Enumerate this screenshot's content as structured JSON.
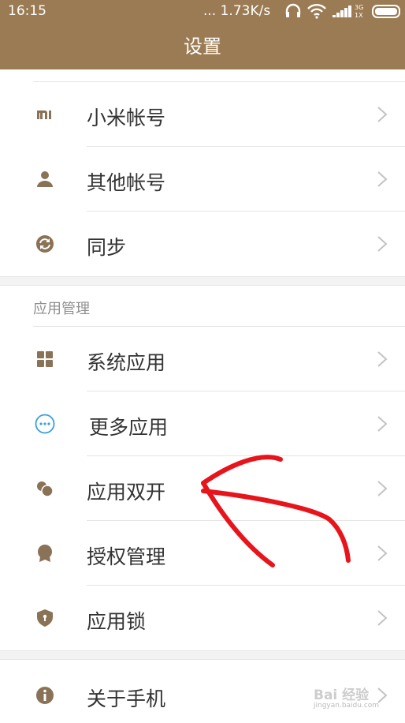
{
  "status_bar": {
    "time": "16:15",
    "network_speed": "... 1.73K/s",
    "signal_label": "3G",
    "signal_sublabel": "1X",
    "icons": [
      "headphone-icon",
      "wifi-icon",
      "signal-icon",
      "battery-icon"
    ]
  },
  "header": {
    "title": "设置"
  },
  "accounts": {
    "items": [
      {
        "label": "小米帐号",
        "icon": "mi-logo-icon"
      },
      {
        "label": "其他帐号",
        "icon": "person-icon"
      },
      {
        "label": "同步",
        "icon": "sync-icon"
      }
    ]
  },
  "app_management": {
    "header": "应用管理",
    "items": [
      {
        "label": "系统应用",
        "icon": "grid-icon"
      },
      {
        "label": "更多应用",
        "icon": "more-dots-icon"
      },
      {
        "label": "应用双开",
        "icon": "dual-app-icon"
      },
      {
        "label": "授权管理",
        "icon": "badge-icon"
      },
      {
        "label": "应用锁",
        "icon": "shield-lock-icon"
      }
    ]
  },
  "about": {
    "items": [
      {
        "label": "关于手机",
        "icon": "info-icon"
      }
    ]
  },
  "watermark": {
    "text": "Bai 经验",
    "subtext": "jingyan.baidu.com"
  },
  "colors": {
    "header_bg": "#9b7b53",
    "icon": "#8a7257",
    "accent_blue": "#3aa0d8",
    "annotation_red": "#e8141c"
  }
}
